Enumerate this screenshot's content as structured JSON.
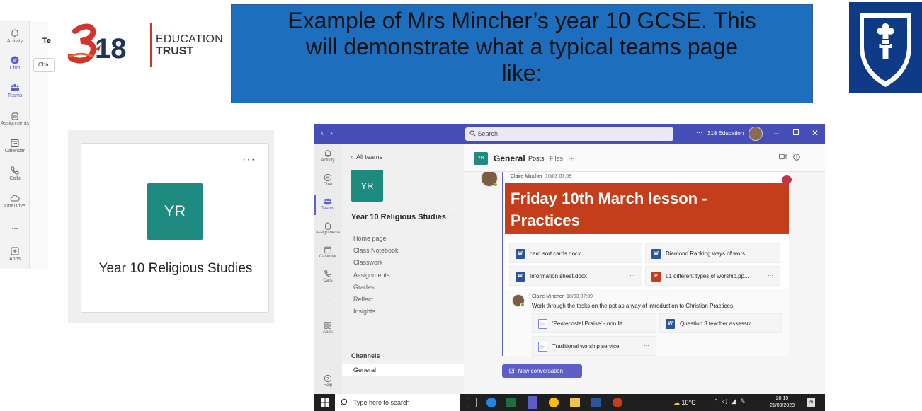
{
  "banner": {
    "line1": "Example of Mrs Mincher’s year 10 GCSE. This",
    "line2": "will demonstrate what a typical teams page",
    "line3": "like:"
  },
  "logo": {
    "numeral": "318",
    "text1": "EDUCATION",
    "text2": "TRUST"
  },
  "left_rail": {
    "items": [
      {
        "label": "Activity",
        "icon": "bell-icon"
      },
      {
        "label": "Chat",
        "icon": "chat-icon"
      },
      {
        "label": "Teams",
        "icon": "teams-icon"
      },
      {
        "label": "Assignments",
        "icon": "backpack-icon"
      },
      {
        "label": "Calendar",
        "icon": "calendar-icon"
      },
      {
        "label": "Calls",
        "icon": "phone-icon"
      },
      {
        "label": "OneDrive",
        "icon": "cloud-icon"
      },
      {
        "label": "...",
        "icon": "more-icon"
      },
      {
        "label": "Apps",
        "icon": "apps-icon"
      }
    ],
    "header_fragment": "Te",
    "tooltip_fragment": "Cha"
  },
  "team_card": {
    "initials": "YR",
    "name": "Year 10 Religious Studies",
    "more": "···"
  },
  "teams_window": {
    "search_placeholder": "Search",
    "org_name": "318 Education",
    "more": "···",
    "app_rail": [
      {
        "label": "Activity",
        "icon": "bell-icon"
      },
      {
        "label": "Chat",
        "icon": "chat-icon"
      },
      {
        "label": "Teams",
        "icon": "teams-icon"
      },
      {
        "label": "Assignments",
        "icon": "backpack-icon"
      },
      {
        "label": "Calendar",
        "icon": "calendar-icon"
      },
      {
        "label": "Calls",
        "icon": "phone-icon"
      },
      {
        "label": "...",
        "icon": "more-icon"
      },
      {
        "label": "Apps",
        "icon": "apps-icon"
      },
      {
        "label": "Help",
        "icon": "help-icon"
      }
    ],
    "channel_pane": {
      "back": "All teams",
      "initials": "YR",
      "team_name": "Year 10 Religious Studies",
      "more": "···",
      "links": [
        "Home page",
        "Class Notebook",
        "Classwork",
        "Assignments",
        "Grades",
        "Reflect",
        "Insights"
      ],
      "channels_header": "Channels",
      "channels": [
        "General"
      ]
    },
    "main": {
      "initials": "YR",
      "channel": "General",
      "tabs": [
        "Posts",
        "Files"
      ],
      "add": "+",
      "post": {
        "author": "Claire Mincher",
        "time": "10/03 07:08",
        "banner_line1": "Friday 10th March lesson -",
        "banner_line2": "Practices",
        "attachments": [
          {
            "name": "card sort cards.docx",
            "type": "word"
          },
          {
            "name": "Diamond Ranking ways of wors...",
            "type": "word"
          },
          {
            "name": "Information sheet.docx",
            "type": "word"
          },
          {
            "name": "L1 different types of worship.pp...",
            "type": "ppt"
          }
        ],
        "reply": {
          "author": "Claire Mincher",
          "time": "10/03 07:09",
          "text": "Work through the tasks on the ppt as a way of introduction to Christian Practices.",
          "attachments": [
            {
              "name": "'Pentecostal Praise' - non lit...",
              "type": "video"
            },
            {
              "name": "Question 3 teacher assessm...",
              "type": "word"
            },
            {
              "name": "Traditional worship service",
              "type": "video"
            }
          ]
        }
      },
      "new_conversation": "New conversation"
    }
  },
  "taskbar": {
    "search_placeholder": "Type here to search",
    "weather": "10°C",
    "time": "20:19",
    "date": "21/09/2023",
    "notifications": "26"
  }
}
